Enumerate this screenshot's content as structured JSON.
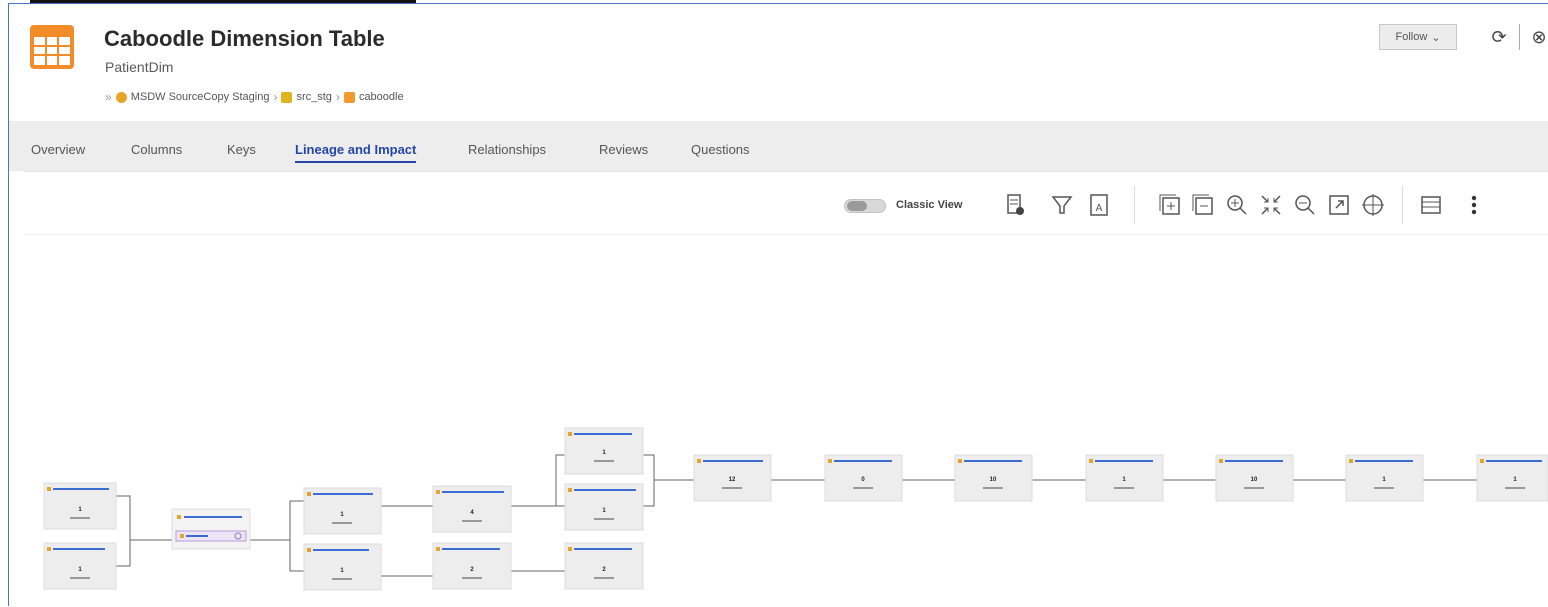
{
  "header": {
    "title": "Caboodle Dimension Table",
    "subtitle": "PatientDim",
    "follow_label": "Follow",
    "breadcrumb": [
      "MSDW SourceCopy Staging",
      "src_stg",
      "caboodle"
    ]
  },
  "tabs": [
    {
      "label": "Overview",
      "active": false
    },
    {
      "label": "Columns",
      "active": false
    },
    {
      "label": "Keys",
      "active": false
    },
    {
      "label": "Lineage and Impact",
      "active": true
    },
    {
      "label": "Relationships",
      "active": false
    },
    {
      "label": "Reviews",
      "active": false
    },
    {
      "label": "Questions",
      "active": false
    }
  ],
  "toolbar": {
    "classic_view_label": "Classic View",
    "icons": [
      "export-icon",
      "filter-icon",
      "text-label-icon",
      "expand-all-icon",
      "collapse-all-icon",
      "zoom-in-icon",
      "fit-icon",
      "zoom-out-icon",
      "fullscreen-icon",
      "center-icon",
      "layout-icon",
      "more-icon"
    ]
  },
  "lineage": {
    "nodes": [
      {
        "id": "n1",
        "count": "1"
      },
      {
        "id": "n2",
        "count": "1"
      },
      {
        "id": "n3",
        "count": ""
      },
      {
        "id": "n4",
        "count": "1"
      },
      {
        "id": "n5",
        "count": "1"
      },
      {
        "id": "n6",
        "count": "4"
      },
      {
        "id": "n7",
        "count": "2"
      },
      {
        "id": "n8",
        "count": "1"
      },
      {
        "id": "n9",
        "count": "1"
      },
      {
        "id": "n10",
        "count": "2"
      },
      {
        "id": "n11",
        "count": "12"
      },
      {
        "id": "n12",
        "count": "0"
      },
      {
        "id": "n13",
        "count": "10"
      },
      {
        "id": "n14",
        "count": "1"
      },
      {
        "id": "n15",
        "count": "10"
      },
      {
        "id": "n16",
        "count": "1"
      },
      {
        "id": "n17",
        "count": "1"
      }
    ]
  },
  "colors": {
    "accent": "#2446a6",
    "asset_icon": "#f28c28",
    "node_bg": "#ededed",
    "selected_node_bg": "#ece4f5"
  }
}
